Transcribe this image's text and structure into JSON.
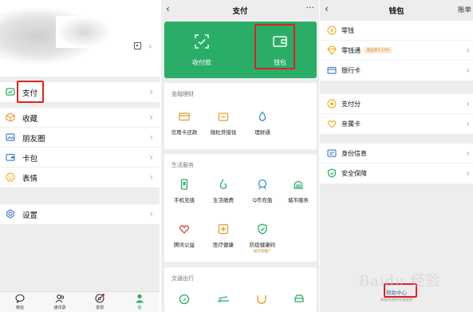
{
  "me": {
    "menu": [
      {
        "label": "支付",
        "icon": "pay-icon"
      },
      {
        "label": "收藏",
        "icon": "favorites-icon"
      },
      {
        "label": "朋友圈",
        "icon": "moments-icon"
      },
      {
        "label": "卡包",
        "icon": "cards-icon"
      },
      {
        "label": "表情",
        "icon": "sticker-icon"
      },
      {
        "label": "设置",
        "icon": "settings-icon"
      }
    ],
    "tabbar": [
      {
        "label": "微信",
        "icon": "chat-icon"
      },
      {
        "label": "通讯录",
        "icon": "contacts-icon"
      },
      {
        "label": "发现",
        "icon": "discover-icon"
      },
      {
        "label": "我",
        "icon": "me-icon"
      }
    ]
  },
  "pay": {
    "title": "支付",
    "more": "···",
    "green": [
      {
        "label": "收付款",
        "icon": "scan-pay-icon"
      },
      {
        "label": "钱包",
        "icon": "wallet-icon"
      }
    ],
    "finance": {
      "header": "金融理财",
      "items": [
        {
          "label": "信用卡还款",
          "icon": "credit-card-icon"
        },
        {
          "label": "微粒贷借钱",
          "icon": "loan-icon"
        },
        {
          "label": "理财通",
          "icon": "wealth-icon"
        }
      ]
    },
    "life": {
      "header": "生活服务",
      "items": [
        {
          "label": "手机充值",
          "icon": "phone-topup-icon"
        },
        {
          "label": "生活缴费",
          "icon": "utility-icon"
        },
        {
          "label": "Q币充值",
          "icon": "qcoin-icon"
        },
        {
          "label": "城市服务",
          "icon": "city-icon"
        },
        {
          "label": "腾讯公益",
          "icon": "charity-icon"
        },
        {
          "label": "医疗健康",
          "icon": "health-icon"
        },
        {
          "label": "防疫健康码",
          "icon": "health-code-icon",
          "sub": "国务院推广"
        }
      ]
    },
    "transport": {
      "header": "交通出行"
    }
  },
  "wallet": {
    "title": "钱包",
    "bill": "账单",
    "group1": [
      {
        "label": "零钱",
        "icon": "change-icon"
      },
      {
        "label": "零钱通",
        "icon": "diamond-icon",
        "badge": "收益率2.11%"
      },
      {
        "label": "银行卡",
        "icon": "bank-card-icon"
      }
    ],
    "group2": [
      {
        "label": "支付分",
        "icon": "pay-score-icon"
      },
      {
        "label": "亲属卡",
        "icon": "family-card-icon"
      }
    ],
    "group3": [
      {
        "label": "身份信息",
        "icon": "id-icon"
      },
      {
        "label": "安全保障",
        "icon": "security-icon"
      }
    ],
    "help": "帮助中心",
    "footer": "本服务由财付通提供"
  },
  "colors": {
    "green": "#2aae67",
    "highlight": "#e02020"
  },
  "watermark": "Baidu 经验"
}
